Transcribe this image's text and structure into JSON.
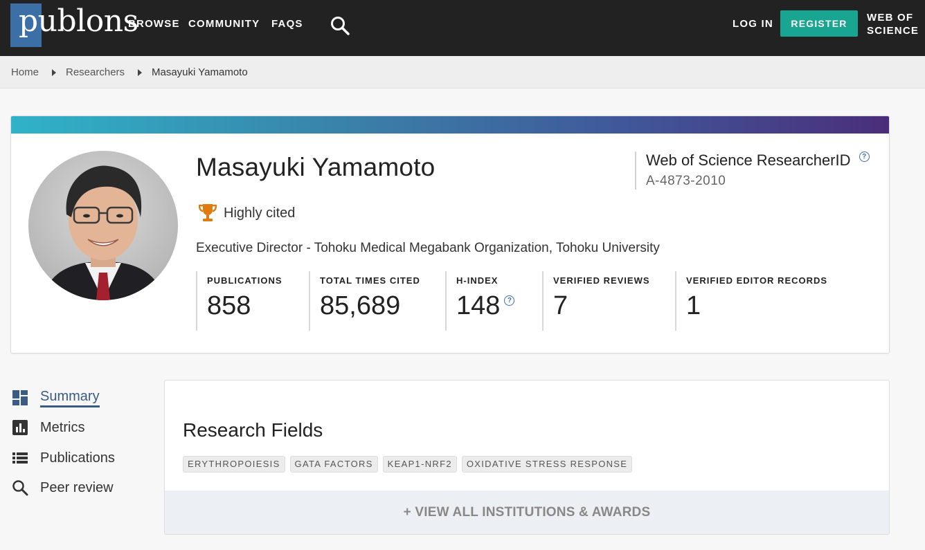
{
  "header": {
    "logo_text": "publons",
    "nav": [
      "BROWSE",
      "COMMUNITY",
      "FAQS"
    ],
    "login": "LOG IN",
    "register": "REGISTER",
    "wos_line1": "WEB OF",
    "wos_line2": "SCIENCE",
    "colors": {
      "bar": "#222222",
      "register": "#18a592",
      "logo_square": "#3b6fa6"
    }
  },
  "breadcrumb": [
    "Home",
    "Researchers",
    "Masayuki Yamamoto"
  ],
  "profile": {
    "name": "Masayuki Yamamoto",
    "badge": "Highly cited",
    "affiliation": "Executive Director - Tohoku Medical Megabank Organization, Tohoku University",
    "researcher_id_label": "Web of Science ResearcherID",
    "researcher_id": "A-4873-2010",
    "metrics": [
      {
        "label": "PUBLICATIONS",
        "value": "858"
      },
      {
        "label": "TOTAL TIMES CITED",
        "value": "85,689"
      },
      {
        "label": "H-INDEX",
        "value": "148"
      },
      {
        "label": "VERIFIED REVIEWS",
        "value": "7"
      },
      {
        "label": "VERIFIED EDITOR RECORDS",
        "value": "1"
      }
    ]
  },
  "sidebar": [
    {
      "label": "Summary",
      "icon": "dashboard-icon",
      "active": true
    },
    {
      "label": "Metrics",
      "icon": "bar-chart-icon"
    },
    {
      "label": "Publications",
      "icon": "list-icon"
    },
    {
      "label": "Peer review",
      "icon": "search-icon"
    }
  ],
  "research_fields": {
    "title": "Research Fields",
    "tags": [
      "ERYTHROPOIESIS",
      "GATA FACTORS",
      "KEAP1-NRF2",
      "OXIDATIVE STRESS RESPONSE"
    ],
    "view_all": "+ VIEW ALL INSTITUTIONS & AWARDS"
  }
}
